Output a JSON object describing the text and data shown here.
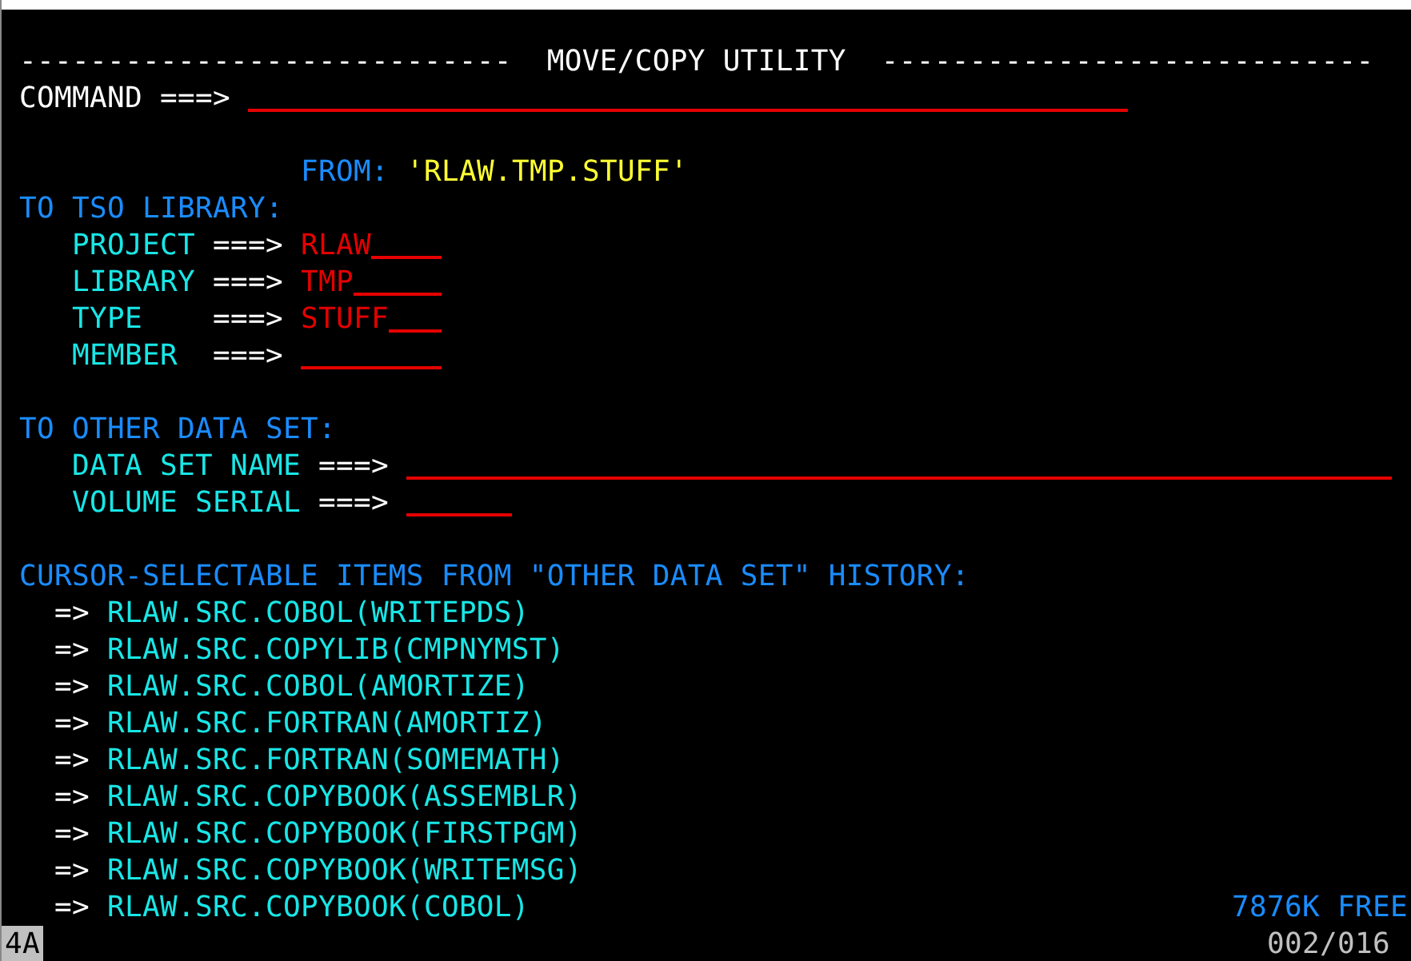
{
  "title_row": {
    "rule_left": "----------------------------",
    "title": "MOVE/COPY UTILITY",
    "rule_right": "----------------------------"
  },
  "command": {
    "label": "COMMAND",
    "prompt": "===>"
  },
  "from": {
    "label": "FROM:",
    "value": "'RLAW.TMP.STUFF'"
  },
  "tso_library": {
    "heading": "TO TSO LIBRARY:",
    "fields": [
      {
        "label": "PROJECT",
        "prompt": "===>",
        "value": "RLAW"
      },
      {
        "label": "LIBRARY",
        "prompt": "===>",
        "value": "TMP"
      },
      {
        "label": "TYPE",
        "prompt": "===>",
        "value": "STUFF"
      },
      {
        "label": "MEMBER",
        "prompt": "===>"
      }
    ]
  },
  "other_data_set": {
    "heading": "TO OTHER DATA SET:",
    "fields": [
      {
        "label": "DATA SET NAME",
        "prompt": "===>"
      },
      {
        "label": "VOLUME SERIAL",
        "prompt": "===>"
      }
    ]
  },
  "history": {
    "heading": "CURSOR-SELECTABLE ITEMS FROM \"OTHER DATA SET\" HISTORY:",
    "items": [
      {
        "marker": "=>",
        "name": "RLAW.SRC.COBOL(WRITEPDS)"
      },
      {
        "marker": "=>",
        "name": "RLAW.SRC.COPYLIB(CMPNYMST)"
      },
      {
        "marker": "=>",
        "name": "RLAW.SRC.COBOL(AMORTIZE)"
      },
      {
        "marker": "=>",
        "name": "RLAW.SRC.FORTRAN(AMORTIZ)"
      },
      {
        "marker": "=>",
        "name": "RLAW.SRC.FORTRAN(SOMEMATH)"
      },
      {
        "marker": "=>",
        "name": "RLAW.SRC.COPYBOOK(ASSEMBLR)"
      },
      {
        "marker": "=>",
        "name": "RLAW.SRC.COPYBOOK(FIRSTPGM)"
      },
      {
        "marker": "=>",
        "name": "RLAW.SRC.COPYBOOK(WRITEMSG)"
      },
      {
        "marker": "=>",
        "name": "RLAW.SRC.COPYBOOK(COBOL)"
      }
    ]
  },
  "free_space": "7876K FREE",
  "status_bar": {
    "session": "4A",
    "position": "002/016"
  }
}
